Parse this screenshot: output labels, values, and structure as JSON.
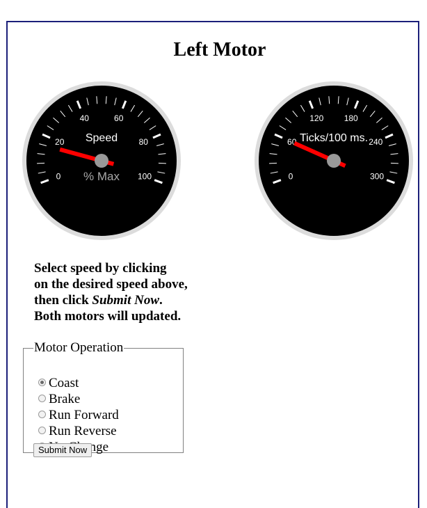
{
  "page": {
    "title": "Left Motor"
  },
  "gauges": {
    "speed": {
      "title": "Speed",
      "units": "% Max",
      "ticks": [
        "0",
        "20",
        "40",
        "60",
        "80",
        "100"
      ],
      "min": 0,
      "max": 100,
      "value": 16
    },
    "ticks": {
      "title": "Ticks/100 ms.",
      "ticks": [
        "0",
        "60",
        "120",
        "180",
        "240",
        "300"
      ],
      "min": 0,
      "max": 300,
      "value": 60
    }
  },
  "instructions": {
    "line1": "Select speed by clicking",
    "line2": "on the desired speed above,",
    "line3_prefix": "then click ",
    "line3_emph": "Submit Now",
    "line3_suffix": ".",
    "line4": "Both motors will updated."
  },
  "motor_operation": {
    "legend": "Motor Operation",
    "options": [
      {
        "label": "Coast",
        "checked": true
      },
      {
        "label": "Brake",
        "checked": false
      },
      {
        "label": "Run Forward",
        "checked": false
      },
      {
        "label": "Run Reverse",
        "checked": false
      },
      {
        "label": "No Change",
        "checked": false
      }
    ],
    "submit_label": "Submit Now"
  },
  "colors": {
    "needle": "#ff0000",
    "dial": "#000000",
    "hub": "#999999",
    "border": "#1b1f7a"
  }
}
